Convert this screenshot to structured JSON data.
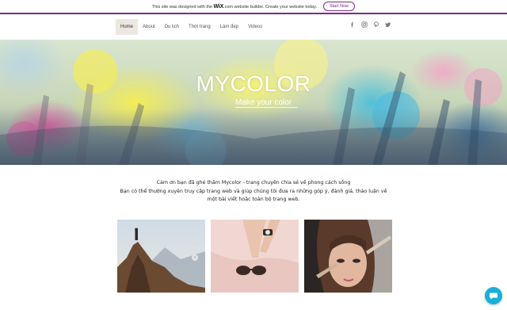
{
  "wix_banner": {
    "text_before": "This site was designed with the",
    "brand": "WiX",
    "text_after": ".com website builder. Create your website today.",
    "cta": "Start Now"
  },
  "nav": {
    "items": [
      {
        "label": "Home",
        "active": true
      },
      {
        "label": "About"
      },
      {
        "label": "Du lịch"
      },
      {
        "label": "Thời trang"
      },
      {
        "label": "Làm đẹp"
      },
      {
        "label": "Videos"
      }
    ]
  },
  "social": [
    "facebook-icon",
    "instagram-icon",
    "pinterest-icon",
    "twitter-icon"
  ],
  "hero": {
    "title": "MYCOLOR",
    "subtitle": "Make your color"
  },
  "intro": {
    "line1": "Cảm ơn bạn đã ghé thăm Mycolor - trang chuyên chia sẻ về phong cách sống",
    "line2": "Bạn có thể thường xuyên truy cập trang web và giúp chúng tôi đưa ra những góp ý, đánh giá, thảo luận về",
    "line3": "một bài viết hoặc toàn bộ trang web."
  },
  "colors": {
    "accent": "#7b2a8a",
    "nav_active_bg": "#ede7e1",
    "chat": "#17b0d6"
  }
}
